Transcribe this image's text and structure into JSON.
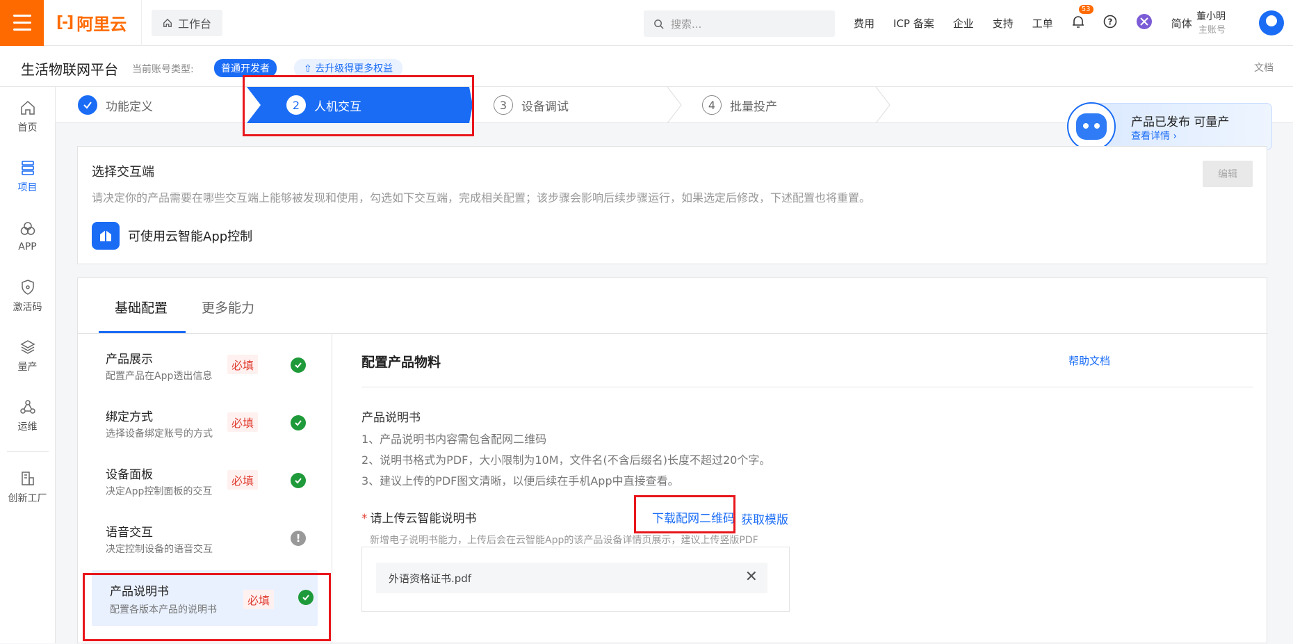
{
  "topbar": {
    "logo_text": "阿里云",
    "workbench_label": "工作台",
    "search_placeholder": "搜索...",
    "nav": [
      "费用",
      "ICP 备案",
      "企业",
      "支持",
      "工单"
    ],
    "notif_count": "53",
    "lang": "简体",
    "user_name": "董小明",
    "user_sub": "主账号"
  },
  "subbar": {
    "platform": "生活物联网平台",
    "acctype_label": "当前账号类型:",
    "dev_tag": "普通开发者",
    "upgrade": "去升级得更多权益",
    "docs": "文档"
  },
  "leftnav": [
    {
      "label": "首页",
      "icon": "home-icon"
    },
    {
      "label": "项目",
      "icon": "project-icon",
      "active": true
    },
    {
      "label": "APP",
      "icon": "app-icon"
    },
    {
      "label": "激活码",
      "icon": "shield-icon"
    },
    {
      "label": "量产",
      "icon": "layers-icon"
    },
    {
      "label": "运维",
      "icon": "nodes-icon"
    },
    {
      "label": "创新工厂",
      "icon": "factory-icon"
    }
  ],
  "steps": [
    {
      "num": "",
      "label": "功能定义",
      "state": "done"
    },
    {
      "num": "2",
      "label": "人机交互",
      "state": "active"
    },
    {
      "num": "3",
      "label": "设备调试",
      "state": "todo"
    },
    {
      "num": "4",
      "label": "批量投产",
      "state": "todo"
    }
  ],
  "promo": {
    "title": "产品已发布 可量产",
    "link": "查看详情 ›"
  },
  "select_card": {
    "title": "选择交互端",
    "desc": "请决定你的产品需要在哪些交互端上能够被发现和使用，勾选如下交互端，完成相关配置；该步骤会影响后续步骤运行，如果选定后修改，下述配置也将重置。",
    "edit": "编辑",
    "app_control": "可使用云智能App控制"
  },
  "tabs": [
    "基础配置",
    "更多能力"
  ],
  "config_items": [
    {
      "title": "产品展示",
      "desc": "配置产品在App透出信息",
      "required": "必填",
      "status": "done"
    },
    {
      "title": "绑定方式",
      "desc": "选择设备绑定账号的方式",
      "required": "必填",
      "status": "done"
    },
    {
      "title": "设备面板",
      "desc": "决定App控制面板的交互",
      "required": "必填",
      "status": "done"
    },
    {
      "title": "语音交互",
      "desc": "决定控制设备的语音交互",
      "required": "",
      "status": "warn"
    },
    {
      "title": "产品说明书",
      "desc": "配置各版本产品的说明书",
      "required": "必填",
      "status": "done",
      "active": true
    }
  ],
  "main": {
    "title": "配置产品物料",
    "help": "帮助文档",
    "manual_label": "产品说明书",
    "lines": [
      "1、产品说明书内容需包含配网二维码",
      "2、说明书格式为PDF，大小限制为10M，文件名(不含后缀名)长度不超过20个字。",
      "3、建议上传的PDF图文清晰，以便后续在手机App中直接查看。"
    ],
    "upload_label": "请上传云智能说明书",
    "download_qr": "下载配网二维码",
    "get_template": "获取模版",
    "upload_hint": "新增电子说明书能力，上传后会在云智能App的该产品设备详情页展示，建议上传竖版PDF",
    "file_name": "外语资格证书.pdf"
  },
  "colors": {
    "brand": "#ff6a00",
    "primary": "#1a6cf5",
    "success": "#1f9a3a",
    "danger": "#e03c31"
  }
}
